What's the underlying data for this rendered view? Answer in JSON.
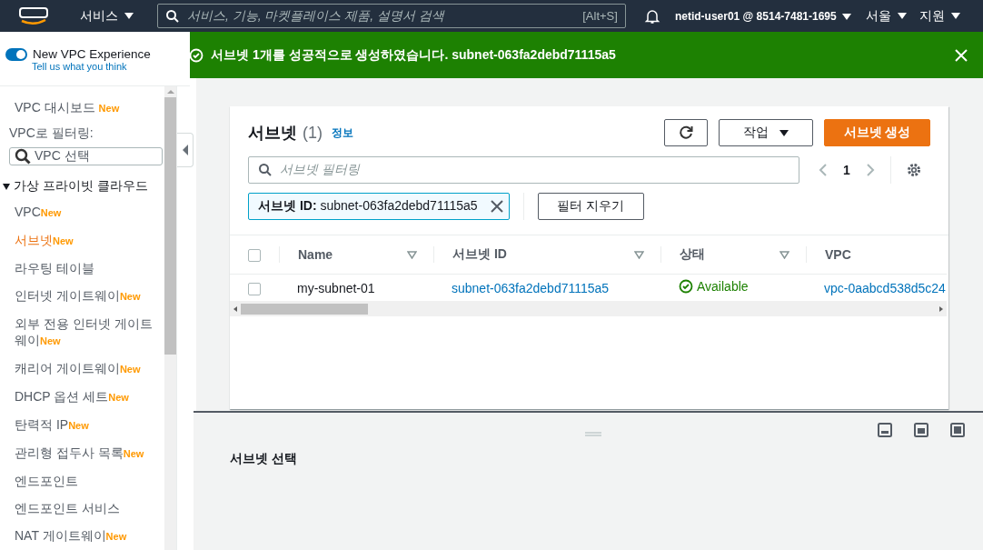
{
  "topbar": {
    "services": "서비스",
    "search_placeholder": "서비스, 기능, 마켓플레이스 제품, 설명서 검색",
    "shortcut": "[Alt+S]",
    "account": "netid-user01 @ 8514-7481-1695",
    "region": "서울",
    "support": "지원"
  },
  "sidebar": {
    "toggle": {
      "label": "New VPC Experience",
      "on": true,
      "feedback": "Tell us what you think"
    },
    "dashboard": {
      "label": "VPC 대시보드",
      "badge": "New"
    },
    "filter_label": "VPC로 필터링:",
    "filter_placeholder": "VPC 선택",
    "section": {
      "label": "가상 프라이빗 클라우드",
      "expanded": true,
      "items": [
        {
          "label": "VPC",
          "badge": "New",
          "selected": false
        },
        {
          "label": "서브넷",
          "badge": "New",
          "selected": true
        },
        {
          "label": "라우팅 테이블",
          "selected": false
        },
        {
          "label": "인터넷 게이트웨이",
          "badge": "New",
          "selected": false
        },
        {
          "label": "외부 전용 인터넷 게이트웨이",
          "badge": "New",
          "selected": false
        },
        {
          "label": "캐리어 게이트웨이",
          "badge": "New",
          "selected": false
        },
        {
          "label": "DHCP 옵션 세트",
          "badge": "New",
          "selected": false
        },
        {
          "label": "탄력적 IP",
          "badge": "New",
          "selected": false
        },
        {
          "label": "관리형 접두사 목록",
          "badge": "New",
          "selected": false
        },
        {
          "label": "엔드포인트",
          "selected": false
        },
        {
          "label": "엔드포인트 서비스",
          "selected": false
        },
        {
          "label": "NAT 게이트웨이",
          "badge": "New",
          "selected": false
        }
      ]
    }
  },
  "flash": {
    "message": "서브넷 1개를 성공적으로 생성하였습니다. subnet-063fa2debd71115a5"
  },
  "panel": {
    "title": "서브넷",
    "count": "(1)",
    "info": "정보",
    "actions": "작업",
    "create": "서브넷 생성",
    "filter_placeholder": "서브넷 필터링",
    "page": "1",
    "token": {
      "key": "서브넷 ID:",
      "value": "subnet-063fa2debd71115a5"
    },
    "clear": "필터 지우기",
    "table": {
      "all_selected": false,
      "columns": [
        "Name",
        "서브넷 ID",
        "상태",
        "VPC"
      ],
      "rows": [
        {
          "selected": false,
          "name": "my-subnet-01",
          "subnet_id": "subnet-063fa2debd71115a5",
          "status": "Available",
          "vpc": "vpc-0aabcd538d5c24"
        }
      ]
    }
  },
  "split": {
    "title": "서브넷 선택"
  }
}
